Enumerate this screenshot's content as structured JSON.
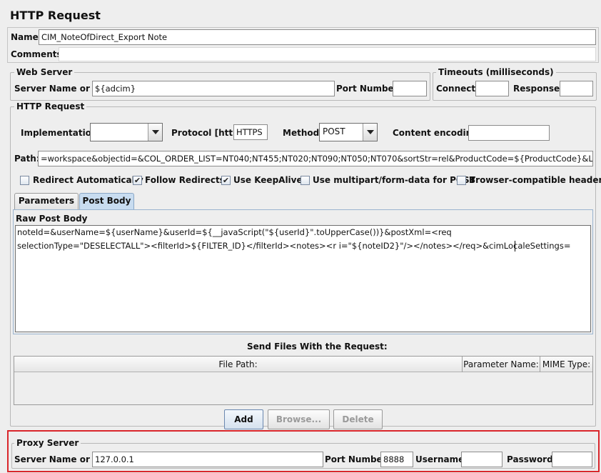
{
  "header": {
    "title": "HTTP Request"
  },
  "general": {
    "name_label": "Name:",
    "name_value": "CIM_NoteOfDirect_Export Note",
    "comments_label": "Comments:"
  },
  "web_server": {
    "legend": "Web Server",
    "server_label": "Server Name or IP:",
    "server_value": "${adcim}",
    "port_label": "Port Number:",
    "port_value": ""
  },
  "timeouts": {
    "legend": "Timeouts (milliseconds)",
    "connect_label": "Connect:",
    "connect_value": "",
    "response_label": "Response:",
    "response_value": ""
  },
  "http_request": {
    "legend": "HTTP Request",
    "implementation_label": "Implementation:",
    "implementation_value": "",
    "protocol_label": "Protocol [http]:",
    "protocol_value": "HTTPS",
    "method_label": "Method:",
    "method_value": "POST",
    "encoding_label": "Content encoding:",
    "encoding_value": "",
    "path_label": "Path:",
    "path_value": "=workspace&objectid=&COL_ORDER_LIST=NT040;NT455;NT020;NT090;NT050;NT070&sortStr=rel&ProductCode=${ProductCode}&Locale=",
    "checkboxes": [
      {
        "label": "Redirect Automatically",
        "checked": false,
        "mark": ""
      },
      {
        "label": "Follow Redirects",
        "checked": true,
        "mark": "✔"
      },
      {
        "label": "Use KeepAlive",
        "checked": true,
        "mark": "✔"
      },
      {
        "label": "Use multipart/form-data for POST",
        "checked": false,
        "mark": ""
      },
      {
        "label": "Browser-compatible headers",
        "checked": false,
        "mark": ""
      }
    ]
  },
  "tabs": [
    {
      "label": "Parameters",
      "active": false
    },
    {
      "label": "Post Body",
      "active": true
    }
  ],
  "post_body": {
    "header": "Raw Post Body",
    "line1": "noteId=&userName=${userName}&userId=${__javaScript(\"${userId}\".toUpperCase())}&postXml=<req",
    "line2": "selectionType=\"DESELECTALL\"><filterId>${FILTER_ID}</filterId><notes><r i=\"${noteID2}\"/></notes></req>&cimLocaleSettings="
  },
  "files": {
    "title": "Send Files With the Request:",
    "columns": [
      "File Path:",
      "Parameter Name:",
      "MIME Type:"
    ],
    "buttons": {
      "add": "Add",
      "browse": "Browse...",
      "delete": "Delete"
    }
  },
  "proxy": {
    "legend": "Proxy Server",
    "server_label": "Server Name or IP:",
    "server_value": "127.0.0.1",
    "port_label": "Port Number:",
    "port_value": "8888",
    "username_label": "Username",
    "username_value": "",
    "password_label": "Password",
    "password_value": ""
  },
  "colors": {
    "highlight_border": "#d9262b",
    "tab_active": "#c8dcf0",
    "panel_bg": "#eeeeee"
  }
}
